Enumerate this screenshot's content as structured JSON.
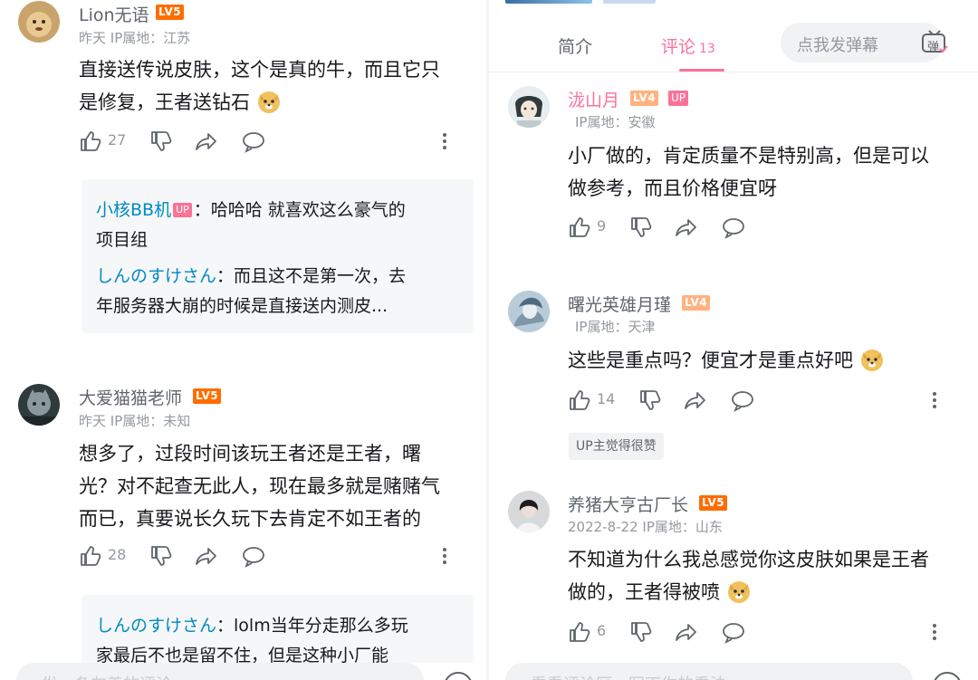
{
  "left": {
    "comments": [
      {
        "username": "Lion无语",
        "level": "LV5",
        "meta": "昨天 IP属地：江苏",
        "lines": [
          "直接送传说皮肤，这个是真的牛，而且它只",
          "是修复，王者送钻石"
        ],
        "likes": "27",
        "replies": [
          {
            "name": "小核BB机",
            "is_up": true,
            "up_label": "UP",
            "text_1": "：哈哈哈 就喜欢这么豪气的",
            "text_2": "项目组"
          },
          {
            "name": "しんのすけさん",
            "text_1": "：而且这不是第一次，去",
            "text_2": "年服务器大崩的时候是直接送内测皮..."
          }
        ]
      },
      {
        "username": "大爱猫猫老师",
        "level": "LV5",
        "meta": "昨天 IP属地：未知",
        "lines": [
          "想多了，过段时间该玩王者还是王者，曙",
          "光？对不起查无此人，现在最多就是赌赌气",
          "而已，真要说长久玩下去肯定不如王者的"
        ],
        "likes": "28",
        "replies": [
          {
            "name": "しんのすけさん",
            "text_1": "：lolm当年分走那么多玩",
            "text_2": "家最后不也是留不住，但是这种小厂能"
          }
        ]
      }
    ],
    "bottom_placeholder": "发一条友善的评论"
  },
  "right": {
    "tabs": {
      "intro": "简介",
      "comments": "评论",
      "comments_count": "13"
    },
    "danmaku_placeholder": "点我发弹幕",
    "danmaku_button": "弹",
    "comments": [
      {
        "username": "泷山月",
        "level": "LV4",
        "up_label": "UP",
        "meta": "IP属地：安徽",
        "lines": [
          "小厂做的，肯定质量不是特别高，但是可以",
          "做参考，而且价格便宜呀"
        ],
        "likes": "9"
      },
      {
        "username": "曙光英雄月瑾",
        "level": "LV4",
        "meta": "IP属地：天津",
        "lines": [
          "这些是重点吗？便宜才是重点好吧"
        ],
        "likes": "14",
        "badge": "UP主觉得很赞"
      },
      {
        "username": "养猪大亨古厂长",
        "level": "LV5",
        "meta": "2022-8-22  IP属地：山东",
        "lines": [
          "不知道为什么我总感觉你这皮肤如果是王者",
          "做的，王者得被喷"
        ],
        "likes": "6"
      }
    ],
    "bottom_placeholder": "看看评论区，写下你的看法"
  },
  "colors": {
    "accent_pink": "#fb7299",
    "reply_name_blue": "#008ac5",
    "lv5_orange": "#ff6c00",
    "lv4_orange": "#ffb27f",
    "meta_gray": "#9499a0"
  }
}
